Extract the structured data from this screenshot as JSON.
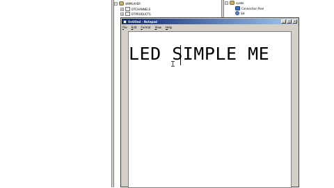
{
  "tree": {
    "root_label": "$MMLAYER",
    "items": [
      {
        "label": "DTCHANNELS"
      },
      {
        "label": "DTPRODUCTS"
      }
    ]
  },
  "right_tree": {
    "root_label": "sysbk",
    "items": [
      {
        "label": "Connection Pool"
      },
      {
        "label": "SH"
      }
    ]
  },
  "notepad": {
    "title": "Untitled - Notepad",
    "menu": [
      "File",
      "Edit",
      "Format",
      "View",
      "Help"
    ],
    "content": "LED SIMPLE ME",
    "buttons": {
      "minimize": "_",
      "maximize": "□",
      "close": "×"
    }
  },
  "colors": {
    "titlebar_start": "#0a246a",
    "titlebar_end": "#a6caf0",
    "window_face": "#d4d0c8"
  },
  "icons": {
    "database": "database-icon",
    "table": "table-icon",
    "connection_pool": "connection-pool-icon",
    "user": "user-icon",
    "notepad": "notepad-icon"
  }
}
